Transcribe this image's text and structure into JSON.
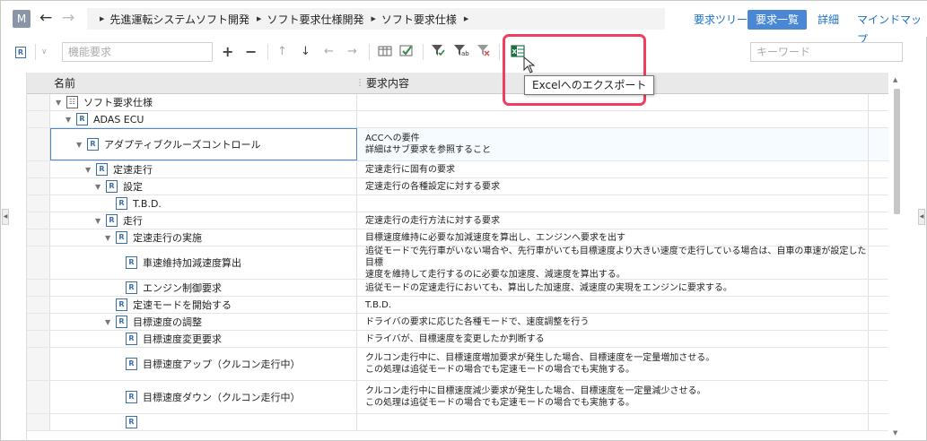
{
  "topbar": {
    "avatar": "M",
    "breadcrumbs": [
      "先進運転システムソフト開発",
      "ソフト要求仕様開発",
      "ソフト要求仕様"
    ],
    "views": [
      {
        "label": "要求ツリー",
        "active": false
      },
      {
        "label": "要求一覧",
        "active": true
      },
      {
        "label": "詳細",
        "active": false
      },
      {
        "label": "マインドマップ",
        "active": false
      }
    ]
  },
  "toolbar": {
    "filter_placeholder": "機能要求",
    "search_placeholder": "キーワード",
    "tooltip": "Excelへのエクスポート"
  },
  "table": {
    "columns": [
      "名前",
      "要求内容"
    ],
    "rows": [
      {
        "name": "ソフト要求仕様",
        "indent": 0,
        "icon": "doc",
        "lines": [
          ""
        ]
      },
      {
        "name": "ADAS ECU",
        "indent": 1,
        "icon": "req",
        "lines": [
          ""
        ]
      },
      {
        "name": "アダプティブクルーズコントロール",
        "indent": 2,
        "icon": "req",
        "selected": true,
        "lines": [
          "ACCへの要件",
          "詳細はサブ要求を参照すること"
        ]
      },
      {
        "name": "定速走行",
        "indent": 3,
        "icon": "req",
        "lines": [
          "定速走行に固有の要求"
        ]
      },
      {
        "name": "設定",
        "indent": 4,
        "icon": "req",
        "lines": [
          "定速走行の各種設定に対する要求"
        ]
      },
      {
        "name": "T.B.D.",
        "indent": 5,
        "icon": "req",
        "leaf": true,
        "lines": [
          ""
        ]
      },
      {
        "name": "走行",
        "indent": 4,
        "icon": "req",
        "lines": [
          "定速走行の走行方法に対する要求"
        ]
      },
      {
        "name": "定速走行の実施",
        "indent": 5,
        "icon": "req",
        "lines": [
          "目標速度維持に必要な加減速度を算出し、エンジンへ要求を出す"
        ]
      },
      {
        "name": "車速維持加減速度算出",
        "indent": 6,
        "icon": "req",
        "leaf": true,
        "lines": [
          "追従モードで先行車がいない場合や、先行車がいても目標速度より大きい速度で走行している場合は、自車の車速が設定した目標",
          "速度を維持して走行するのに必要な加速度、減速度を算出する。"
        ]
      },
      {
        "name": "エンジン制御要求",
        "indent": 6,
        "icon": "req",
        "leaf": true,
        "lines": [
          "追従モードの定速走行においても、算出した加速度、減速度の実現をエンジンに要求する。"
        ]
      },
      {
        "name": "定速モードを開始する",
        "indent": 5,
        "icon": "req",
        "leaf": true,
        "lines": [
          "T.B.D."
        ]
      },
      {
        "name": "目標速度の調整",
        "indent": 5,
        "icon": "req",
        "lines": [
          "ドライバの要求に応じた各種モードで、速度調整を行う"
        ]
      },
      {
        "name": "目標速度変更要求",
        "indent": 6,
        "icon": "req",
        "leaf": true,
        "lines": [
          "ドライバが、目標速度を変更したか判断する"
        ]
      },
      {
        "name": "目標速度アップ（クルコン走行中）",
        "indent": 6,
        "icon": "req",
        "leaf": true,
        "lines": [
          "クルコン走行中に、目標速度増加要求が発生した場合、目標速度を一定量増加させる。",
          "この処理は追従モードの場合でも定速モードの場合でも実施する。"
        ]
      },
      {
        "name": "目標速度ダウン（クルコン走行中）",
        "indent": 6,
        "icon": "req",
        "leaf": true,
        "lines": [
          "クルコン走行中に目標速度減少要求が発生した場合、目標速度を一定量減少させる。",
          "この処理は追従モードの場合でも定速モードの場合でも実施する。"
        ]
      },
      {
        "name": "",
        "indent": 6,
        "icon": "req",
        "leaf": true,
        "lines": [
          ""
        ]
      }
    ]
  }
}
